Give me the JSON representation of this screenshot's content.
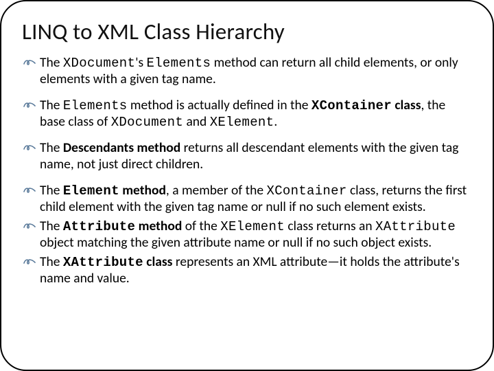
{
  "title": "LINQ to XML Class Hierarchy",
  "items": [
    {
      "pre": "The ",
      "code1": "XDocument",
      "mid1": "'s ",
      "code2": "Elements",
      "post": " method can return all child elements, or only elements with a given tag name."
    },
    {
      "pre": "The ",
      "code1": "Elements",
      "mid1": " method is actually defined in the ",
      "code_b1": "XContainer",
      "mid_b1": " class",
      "mid2": ", the base class of ",
      "code2": "XDocument",
      "mid3": " and ",
      "code3": "XElement",
      "post": "."
    },
    {
      "pre": "The ",
      "b1": "Descendants method",
      "post": " returns all descendant elements with the given tag name, not just direct children."
    },
    {
      "pre": "The ",
      "code_b1": "Element",
      "mid_b1": " method",
      "mid1": ", a member of the ",
      "code1": "XContainer",
      "post": " class, returns the first child element with the given tag name or null if no such element exists."
    },
    {
      "pre": "The ",
      "code_b1": "Attribute",
      "mid_b1": " method",
      "mid1": " of the ",
      "code1": "XElement",
      "mid2": " class returns an ",
      "code2": "XAttribute",
      "post": " object matching the given attribute name or null if no such object exists."
    },
    {
      "pre": "The ",
      "code_b1": "XAttribute",
      "mid_b1": " class",
      "post": " represents an XML attribute—it holds the attribute's name and value."
    }
  ]
}
